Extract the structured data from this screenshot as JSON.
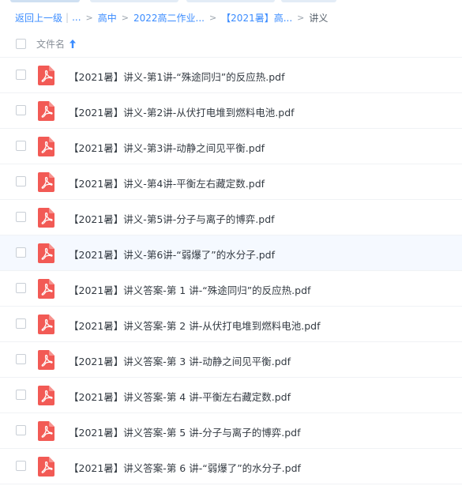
{
  "breadcrumb": {
    "back": "返回上一级",
    "ellipsis": "...",
    "crumbs": [
      "高中",
      "2022高二作业...",
      "【2021暑】高..."
    ],
    "current": "讲义"
  },
  "header": {
    "name_label": "文件名"
  },
  "files": [
    "【2021暑】讲义-第1讲-“殊途同归”的反应热.pdf",
    "【2021暑】讲义-第2讲-从伏打电堆到燃料电池.pdf",
    "【2021暑】讲义-第3讲-动静之间见平衡.pdf",
    "【2021暑】讲义-第4讲-平衡左右藏定数.pdf",
    "【2021暑】讲义-第5讲-分子与离子的博弈.pdf",
    "【2021暑】讲义-第6讲-“弱爆了”的水分子.pdf",
    "【2021暑】讲义答案-第 1 讲-“殊途同归”的反应热.pdf",
    "【2021暑】讲义答案-第 2 讲-从伏打电堆到燃料电池.pdf",
    "【2021暑】讲义答案-第 3 讲-动静之间见平衡.pdf",
    "【2021暑】讲义答案-第 4 讲-平衡左右藏定数.pdf",
    "【2021暑】讲义答案-第 5 讲-分子与离子的博弈.pdf",
    "【2021暑】讲义答案-第 6 讲-“弱爆了”的水分子.pdf"
  ],
  "icons": {
    "file_type": "pdf-icon",
    "sort": "sort-ascending-arrow-icon"
  },
  "colors": {
    "link": "#3b8cff",
    "pdf_red": "#f25a55",
    "hover_row": "#f5f9ff"
  }
}
